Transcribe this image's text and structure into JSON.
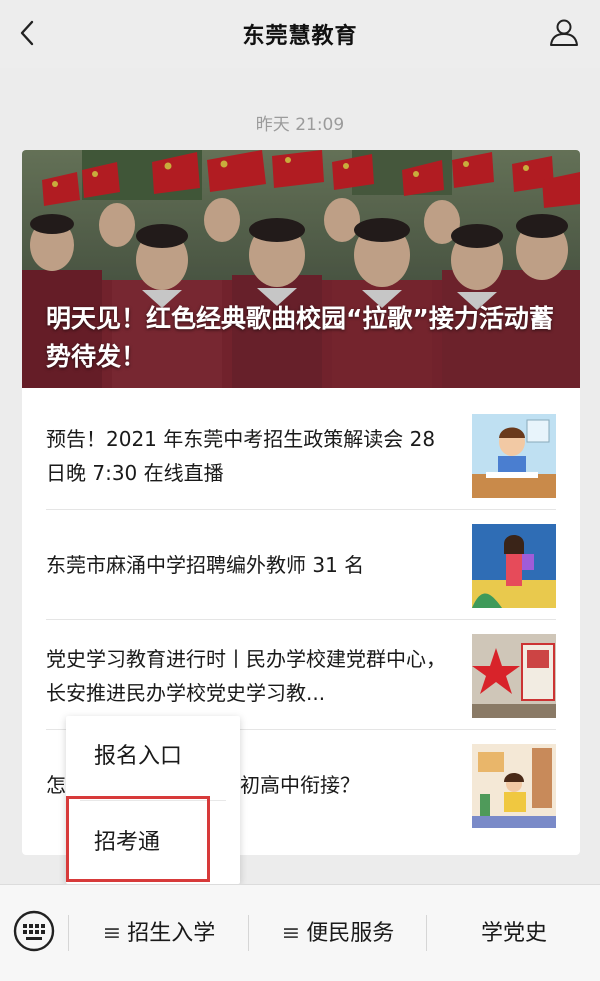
{
  "header": {
    "title": "东莞慧教育"
  },
  "message": {
    "timestamp": "昨天 21:09"
  },
  "hero": {
    "title": "明天见！红色经典歌曲校园“拉歌”接力活动蓄势待发！"
  },
  "articles": [
    {
      "title": "预告！2021 年东莞中考招生政策解读会 28 日晚 7:30 在线直播"
    },
    {
      "title": "东莞市麻涌中学招聘编外教师 31 名"
    },
    {
      "title": "党史学习教育进行时丨民办学校建党群中心，长安推进民办学校党史学习教..."
    },
    {
      "title_start": "怎",
      "title_end": "初高中衔接？"
    }
  ],
  "popup_menu": {
    "items": [
      "报名入口",
      "招考通"
    ]
  },
  "bottom_menu": {
    "items": [
      {
        "label": "招生入学",
        "icon": "≡"
      },
      {
        "label": "便民服务",
        "icon": "≡"
      },
      {
        "label": "学党史"
      }
    ]
  },
  "colors": {
    "highlight": "#d73a3a",
    "flag_red": "#d8232a",
    "uniform": "#8a2a36"
  }
}
